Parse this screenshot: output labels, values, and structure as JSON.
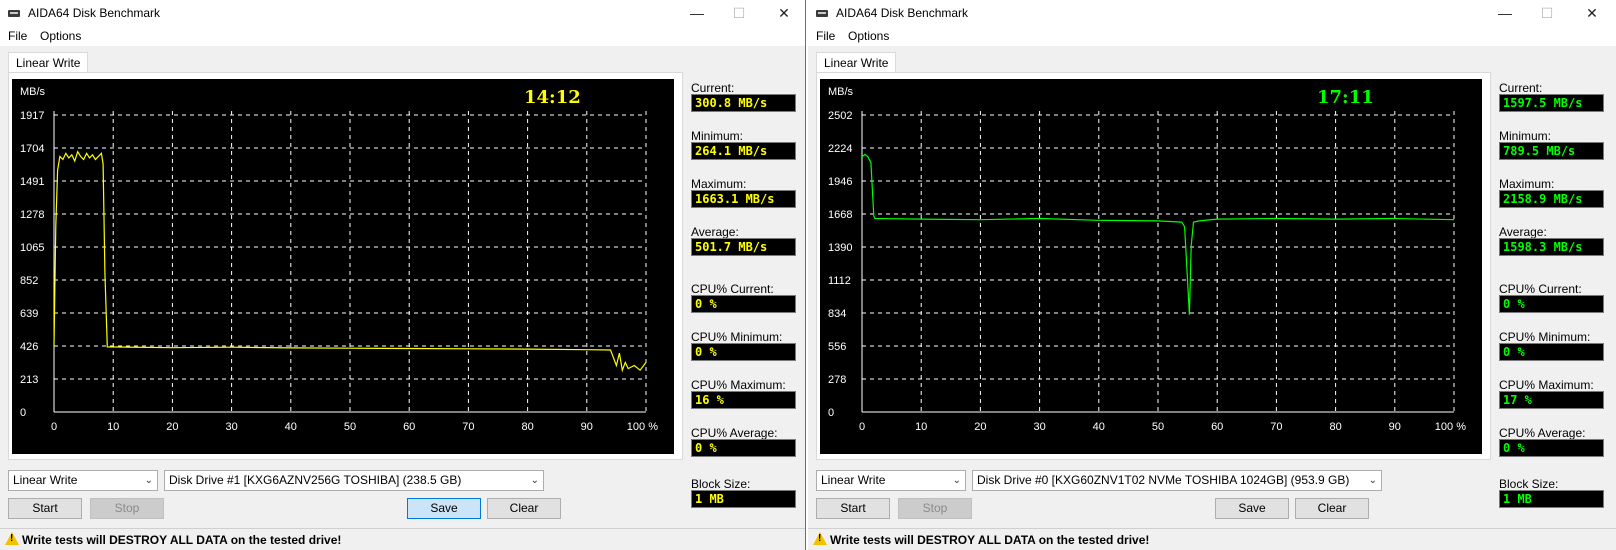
{
  "windows": [
    {
      "title": "AIDA64 Disk Benchmark",
      "menu": [
        "File",
        "Options"
      ],
      "tab": "Linear Write",
      "accent": "#ffff00",
      "chart_data": {
        "type": "line",
        "ylabel": "MB/s",
        "yticks": [
          "1917",
          "1704",
          "1491",
          "1278",
          "1065",
          "852",
          "639",
          "426",
          "213",
          "0"
        ],
        "ylim": [
          0,
          2130
        ],
        "xticks": [
          "0",
          "10",
          "20",
          "30",
          "40",
          "50",
          "60",
          "70",
          "80",
          "90",
          "100 %"
        ],
        "xlim": [
          0,
          100
        ],
        "grid": true,
        "timer": "14:12",
        "series_color": "#ffff00",
        "x": [
          0,
          0.3,
          0.6,
          1.0,
          1.5,
          2.0,
          2.5,
          3.0,
          3.5,
          4.0,
          4.5,
          5.0,
          5.5,
          6.0,
          6.5,
          7.0,
          7.5,
          8.0,
          8.3,
          8.6,
          9.0,
          20,
          30,
          40,
          50,
          60,
          70,
          80,
          90,
          94,
          95,
          95.5,
          96,
          96.5,
          97,
          98,
          99,
          100
        ],
        "y": [
          430,
          1200,
          1560,
          1650,
          1630,
          1670,
          1640,
          1660,
          1620,
          1680,
          1650,
          1630,
          1670,
          1640,
          1660,
          1630,
          1650,
          1670,
          1600,
          900,
          420,
          415,
          418,
          414,
          412,
          410,
          408,
          406,
          402,
          400,
          300,
          380,
          270,
          320,
          280,
          300,
          270,
          320
        ]
      },
      "stats": [
        {
          "label": "Current:",
          "value": "300.8 MB/s"
        },
        {
          "label": "Minimum:",
          "value": "264.1 MB/s"
        },
        {
          "label": "Maximum:",
          "value": "1663.1 MB/s"
        },
        {
          "label": "Average:",
          "value": "501.7 MB/s"
        },
        {
          "label": "CPU% Current:",
          "value": "0 %"
        },
        {
          "label": "CPU% Minimum:",
          "value": "0 %"
        },
        {
          "label": "CPU% Maximum:",
          "value": "16 %"
        },
        {
          "label": "CPU% Average:",
          "value": "0 %"
        },
        {
          "label": "Block Size:",
          "value": "1 MB"
        }
      ],
      "test_select": "Linear Write",
      "drive_select": "Disk Drive #1  [KXG6AZNV256G TOSHIBA]  (238.5 GB)",
      "buttons": {
        "start": "Start",
        "stop": "Stop",
        "save": "Save",
        "clear": "Clear"
      },
      "warning": "Write tests will DESTROY ALL DATA on the tested drive!"
    },
    {
      "title": "AIDA64 Disk Benchmark",
      "menu": [
        "File",
        "Options"
      ],
      "tab": "Linear Write",
      "accent": "#00ff00",
      "chart_data": {
        "type": "line",
        "ylabel": "MB/s",
        "yticks": [
          "2502",
          "2224",
          "1946",
          "1668",
          "1390",
          "1112",
          "834",
          "556",
          "278",
          "0"
        ],
        "ylim": [
          0,
          2780
        ],
        "xticks": [
          "0",
          "10",
          "20",
          "30",
          "40",
          "50",
          "60",
          "70",
          "80",
          "90",
          "100 %"
        ],
        "xlim": [
          0,
          100
        ],
        "grid": true,
        "timer": "17:11",
        "series_color": "#00ff00",
        "x": [
          0,
          0.5,
          1.0,
          1.5,
          2.0,
          2.2,
          10,
          20,
          30,
          40,
          50,
          54,
          54.5,
          55,
          55.3,
          55.6,
          56,
          57,
          60,
          70,
          80,
          90,
          100
        ],
        "y": [
          2150,
          2170,
          2150,
          2100,
          1650,
          1630,
          1625,
          1620,
          1630,
          1615,
          1610,
          1600,
          1560,
          1100,
          820,
          1400,
          1600,
          1610,
          1625,
          1630,
          1625,
          1630,
          1620
        ]
      },
      "stats": [
        {
          "label": "Current:",
          "value": "1597.5 MB/s"
        },
        {
          "label": "Minimum:",
          "value": "789.5 MB/s"
        },
        {
          "label": "Maximum:",
          "value": "2158.9 MB/s"
        },
        {
          "label": "Average:",
          "value": "1598.3 MB/s"
        },
        {
          "label": "CPU% Current:",
          "value": "0 %"
        },
        {
          "label": "CPU% Minimum:",
          "value": "0 %"
        },
        {
          "label": "CPU% Maximum:",
          "value": "17 %"
        },
        {
          "label": "CPU% Average:",
          "value": "0 %"
        },
        {
          "label": "Block Size:",
          "value": "1 MB"
        }
      ],
      "test_select": "Linear Write",
      "drive_select": "Disk Drive #0  [KXG60ZNV1T02 NVMe TOSHIBA 1024GB]  (953.9 GB)",
      "buttons": {
        "start": "Start",
        "stop": "Stop",
        "save": "Save",
        "clear": "Clear"
      },
      "warning": "Write tests will DESTROY ALL DATA on the tested drive!"
    }
  ]
}
